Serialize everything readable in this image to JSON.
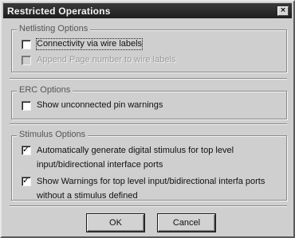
{
  "dialog": {
    "title": "Restricted Operations",
    "close_symbol": "×"
  },
  "netlisting": {
    "title": "Netlisting Options",
    "options": [
      {
        "label": "Connectivity via wire labels",
        "checked": false,
        "disabled": false
      },
      {
        "label": "Append Page number to wire labels",
        "checked": false,
        "disabled": true
      }
    ]
  },
  "erc": {
    "title": "ERC Options",
    "options": [
      {
        "label": "Show unconnected pin warnings",
        "checked": false,
        "disabled": false
      }
    ]
  },
  "stimulus": {
    "title": "Stimulus Options",
    "options": [
      {
        "label": "Automatically generate digital stimulus for top level input/bidirectional interface ports",
        "checked": true,
        "disabled": false
      },
      {
        "label": "Show Warnings for top level input/bidirectional interfa ports without a stimulus defined",
        "checked": true,
        "disabled": false
      }
    ]
  },
  "buttons": {
    "ok": "OK",
    "cancel": "Cancel"
  }
}
